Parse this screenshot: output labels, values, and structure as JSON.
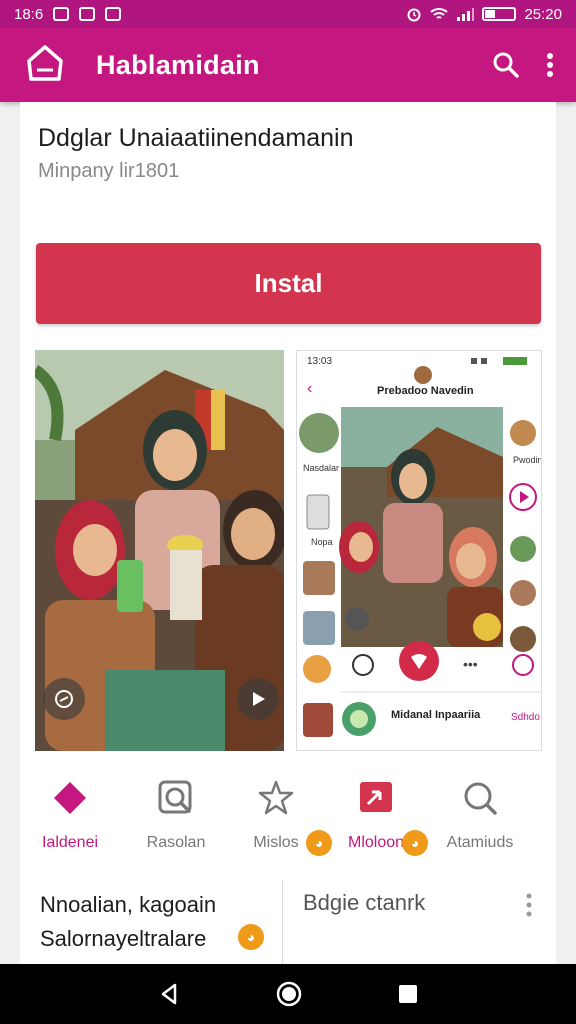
{
  "status_bar": {
    "time_left": "18:6",
    "time_right": "25:20"
  },
  "app_bar": {
    "title": "Hablamidain"
  },
  "app": {
    "name": "Ddglar Unaiaatiinendamanin",
    "developer": "Minpany lir1801",
    "install_label": "Instal"
  },
  "screenshot_2": {
    "status_time": "13:03",
    "header_title": "Prebadoo Navedin",
    "side_label_1": "Nasdalar",
    "side_label_2": "Pwodin",
    "side_label_3": "Nopa",
    "bottom_title": "Midanal Inpaariia",
    "bottom_side": "Sdhdo"
  },
  "tabs": [
    {
      "label": "Ialdenei",
      "icon": "diamond-icon",
      "active": true
    },
    {
      "label": "Rasolan",
      "icon": "search-card-icon",
      "active": false
    },
    {
      "label": "Mislos",
      "icon": "star-icon",
      "active": false
    },
    {
      "label": "Mloloon",
      "icon": "tag-icon",
      "active": false
    },
    {
      "label": "Atamiuds",
      "icon": "magnifier-icon",
      "active": false
    }
  ],
  "section_left": {
    "line1": "Nnoalian, kagoain",
    "line2": "Salornayeltralare"
  },
  "section_right": {
    "title": "Bdgie ctanrk"
  },
  "colors": {
    "brand": "#c4177f",
    "install": "#d4354e",
    "status_bar": "#b1157f"
  }
}
